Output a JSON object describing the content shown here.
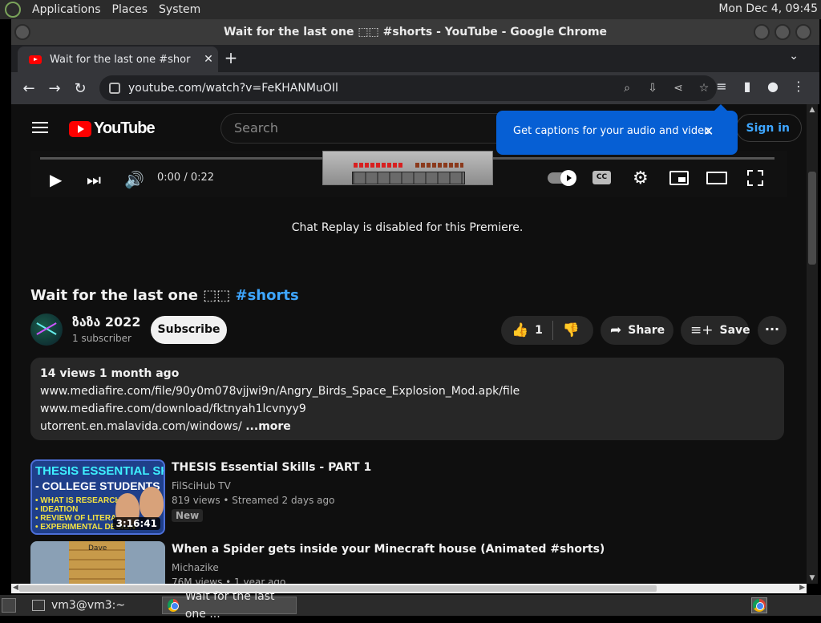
{
  "panel": {
    "menus": [
      "Applications",
      "Places",
      "System"
    ],
    "clock": "Mon Dec  4, 09:45"
  },
  "window": {
    "title": "Wait for the last one ⬚⬚ #shorts - YouTube - Google Chrome"
  },
  "browser": {
    "tab_title": "Wait for the last one  #shor",
    "url": "youtube.com/watch?v=FeKHANMuOIl"
  },
  "youtube": {
    "logo_text": "YouTube",
    "search_placeholder": "Search",
    "signin": "Sign in",
    "tooltip": "Get captions for your audio and video",
    "player": {
      "time": "0:00 / 0:22",
      "progress_fraction": 0.0,
      "cc_label": "CC"
    },
    "chat_replay": "Chat Replay is disabled for this Premiere.",
    "video": {
      "title": "Wait for the last one ⬚⬚ ",
      "hashtag": "#shorts",
      "channel": "ზაზა 2022",
      "subscribers": "1 subscriber",
      "subscribe": "Subscribe",
      "likes": "1",
      "share": "Share",
      "save": "Save"
    },
    "description": {
      "meta": "14 views  1 month ago",
      "lines": [
        "www.mediafire.com/file/90y0m078vjjwi9n/Angry_Birds_Space_Explosion_Mod.apk/file",
        "www.mediafire.com/download/fktnyah1lcvnyy9",
        "utorrent.en.malavida.com/windows/"
      ],
      "more": "...more"
    },
    "recommendations": [
      {
        "title": "THESIS Essential Skills - PART 1",
        "channel": "FilSciHub TV",
        "meta": "819 views  • Streamed 2 days ago",
        "badge": "New",
        "duration": "3:16:41",
        "thumb": {
          "line1": "THESIS ESSENTIAL SKILLS",
          "line2": "- COLLEGE STUDENTS",
          "bullets": [
            "• WHAT IS RESEARCH?",
            "• IDEATION",
            "• REVIEW OF LITERATURE",
            "• EXPERIMENTAL DESIGN"
          ]
        }
      },
      {
        "title": "When a Spider gets inside your Minecraft house (Animated #shorts)",
        "channel": "Michazike",
        "meta": "76M views  • 1 year ago",
        "thumb": {
          "sign": "Dave"
        }
      }
    ]
  },
  "taskbar": {
    "terminal": "vm3@vm3:~",
    "chrome": "Wait for the last one ..."
  }
}
